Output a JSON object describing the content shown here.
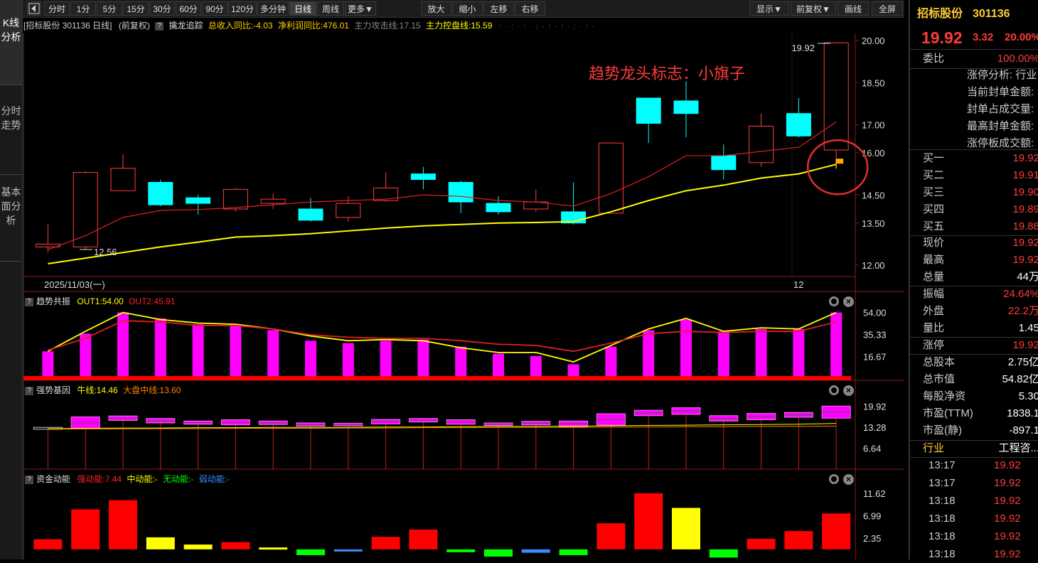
{
  "sidebar": {
    "tabs": [
      {
        "label": "K线分析",
        "active": true
      },
      {
        "label": "分时走势",
        "active": false
      },
      {
        "label": "基本面分析",
        "active": false
      }
    ]
  },
  "toolbar": {
    "back_icon": "triangle-left-icon",
    "periods": [
      "分时",
      "1分",
      "5分",
      "15分",
      "30分",
      "60分",
      "90分",
      "120分",
      "多分钟",
      "日线",
      "周线",
      "更多▼"
    ],
    "active_period": "日线",
    "actions": [
      "放大",
      "缩小",
      "左移",
      "右移"
    ],
    "right": [
      "显示▼",
      "前复权▼",
      "画线",
      "全屏"
    ]
  },
  "infobar": {
    "stock": "[招标股份 301136 日线]",
    "adjust": "(前复权)",
    "indicator": "擒龙追踪",
    "rev_label": "总收入同比:-4.03",
    "profit_label": "净利润同比:476.01",
    "attack_label": "主力攻击线:17.15",
    "control_label": "主力控盘线:15.59"
  },
  "annotation": "趋势龙头标志：小旗子",
  "main_chart": {
    "y_ticks": [
      "20.00",
      "18.50",
      "17.00",
      "16.00",
      "14.50",
      "13.50",
      "12.00"
    ],
    "date_label": "2025/11/03(一)",
    "month_label": "12",
    "high_label": "19.92",
    "low_label": "12.56"
  },
  "chart_data": {
    "type": "candlestick",
    "ylim": [
      12.0,
      20.0
    ],
    "candles": [
      {
        "o": 12.65,
        "c": 12.75,
        "h": 13.45,
        "l": 12.45,
        "up": true
      },
      {
        "o": 12.65,
        "c": 15.3,
        "h": 15.35,
        "l": 12.56,
        "up": true
      },
      {
        "o": 14.65,
        "c": 15.45,
        "h": 15.95,
        "l": 14.65,
        "up": true
      },
      {
        "o": 14.95,
        "c": 14.15,
        "h": 15.05,
        "l": 14.1,
        "up": false
      },
      {
        "o": 14.4,
        "c": 14.2,
        "h": 14.5,
        "l": 13.8,
        "up": false
      },
      {
        "o": 14.0,
        "c": 14.7,
        "h": 14.75,
        "l": 13.9,
        "up": true
      },
      {
        "o": 14.2,
        "c": 14.35,
        "h": 14.55,
        "l": 14.0,
        "up": true
      },
      {
        "o": 14.0,
        "c": 13.6,
        "h": 14.4,
        "l": 13.55,
        "up": false
      },
      {
        "o": 13.7,
        "c": 14.2,
        "h": 14.45,
        "l": 13.55,
        "up": true
      },
      {
        "o": 14.3,
        "c": 14.75,
        "h": 15.3,
        "l": 14.25,
        "up": true
      },
      {
        "o": 15.25,
        "c": 15.05,
        "h": 15.5,
        "l": 14.7,
        "up": false
      },
      {
        "o": 14.95,
        "c": 14.25,
        "h": 15.0,
        "l": 13.85,
        "up": false
      },
      {
        "o": 14.2,
        "c": 13.9,
        "h": 14.45,
        "l": 13.8,
        "up": false
      },
      {
        "o": 14.0,
        "c": 14.25,
        "h": 14.7,
        "l": 13.9,
        "up": true
      },
      {
        "o": 13.9,
        "c": 13.5,
        "h": 14.95,
        "l": 13.45,
        "up": false
      },
      {
        "o": 13.85,
        "c": 16.35,
        "h": 16.35,
        "l": 13.85,
        "up": true
      },
      {
        "o": 17.95,
        "c": 17.05,
        "h": 17.95,
        "l": 16.35,
        "up": false
      },
      {
        "o": 17.85,
        "c": 17.4,
        "h": 18.55,
        "l": 16.55,
        "up": false
      },
      {
        "o": 15.9,
        "c": 15.4,
        "h": 16.3,
        "l": 15.05,
        "up": false
      },
      {
        "o": 15.65,
        "c": 16.95,
        "h": 17.4,
        "l": 15.5,
        "up": true
      },
      {
        "o": 17.4,
        "c": 16.6,
        "h": 17.95,
        "l": 16.55,
        "up": false
      },
      {
        "o": 16.1,
        "c": 19.92,
        "h": 19.92,
        "l": 15.8,
        "up": true
      }
    ],
    "ma_red": [
      12.55,
      13.05,
      13.7,
      13.95,
      13.98,
      14.05,
      14.15,
      14.25,
      14.3,
      14.35,
      14.5,
      14.45,
      14.3,
      14.25,
      14.1,
      14.55,
      15.15,
      15.9,
      15.9,
      16.05,
      16.2,
      17.1
    ],
    "ma_yellow": [
      12.05,
      12.25,
      12.45,
      12.65,
      12.82,
      13.0,
      13.05,
      13.12,
      13.22,
      13.32,
      13.4,
      13.45,
      13.5,
      13.52,
      13.55,
      13.9,
      14.3,
      14.65,
      14.85,
      15.1,
      15.25,
      15.59
    ],
    "resonance": {
      "title": "趋势共振",
      "out1": "OUT1:54.00",
      "out2": "OUT2:45.91",
      "y_ticks": [
        "54.00",
        "35.33",
        "16.67"
      ],
      "ylim": [
        0,
        60
      ],
      "bars": [
        21,
        36,
        54,
        49,
        44,
        44,
        39,
        30,
        28,
        30,
        31,
        25,
        19,
        17,
        10,
        25,
        39,
        48,
        38,
        40,
        40,
        54
      ],
      "line1": [
        21,
        38,
        54,
        48,
        45,
        44,
        40,
        34,
        30,
        31,
        30,
        24,
        20,
        20,
        12,
        26,
        40,
        49,
        38,
        41,
        40,
        54
      ],
      "line2": [
        22,
        32,
        47,
        46,
        43,
        43,
        40,
        35,
        33,
        32,
        32,
        30,
        27,
        26,
        21,
        28,
        36,
        38,
        37,
        38,
        38,
        46
      ]
    },
    "gene": {
      "title": "强势基因",
      "bull": "牛线:14.46",
      "market": "大盘中线:13.60",
      "y_ticks": [
        "19.92",
        "13.28",
        "6.64"
      ],
      "ylim": [
        0,
        22
      ],
      "boxes": [
        [
          12.6,
          13.2
        ],
        [
          12.8,
          16.5
        ],
        [
          15.4,
          16.8
        ],
        [
          14.6,
          16.0
        ],
        [
          14.2,
          15.2
        ],
        [
          14.0,
          15.6
        ],
        [
          14.1,
          15.2
        ],
        [
          13.6,
          14.6
        ],
        [
          13.7,
          14.5
        ],
        [
          14.3,
          15.7
        ],
        [
          14.9,
          16.0
        ],
        [
          14.2,
          15.6
        ],
        [
          13.8,
          14.6
        ],
        [
          14.0,
          15.1
        ],
        [
          13.4,
          15.2
        ],
        [
          13.9,
          17.5
        ],
        [
          16.9,
          18.6
        ],
        [
          17.3,
          19.4
        ],
        [
          15.2,
          16.9
        ],
        [
          15.6,
          17.6
        ],
        [
          16.4,
          17.9
        ],
        [
          16.1,
          19.9
        ]
      ],
      "bull_line": [
        12.8,
        12.9,
        13.0,
        13.0,
        13.1,
        13.1,
        13.2,
        13.2,
        13.2,
        13.3,
        13.3,
        13.4,
        13.5,
        13.5,
        13.6,
        13.7,
        13.8,
        13.9,
        14.0,
        14.1,
        14.2,
        14.46
      ],
      "market_line": [
        12.6,
        12.7,
        12.7,
        12.8,
        12.8,
        12.9,
        12.9,
        12.9,
        13.0,
        13.0,
        13.1,
        13.1,
        13.2,
        13.2,
        13.2,
        13.3,
        13.3,
        13.4,
        13.4,
        13.5,
        13.5,
        13.6
      ]
    },
    "fund": {
      "title": "资金动能",
      "strong": "强动能:7.44",
      "mid": "中动能:-",
      "none": "无动能:-",
      "weak": "弱动能:-",
      "y_ticks": [
        "11.62",
        "6.99",
        "2.35"
      ],
      "ylim": [
        -1.5,
        12.5
      ],
      "bars": [
        {
          "v": 2.1,
          "c": "#ff0000"
        },
        {
          "v": 8.3,
          "c": "#ff0000"
        },
        {
          "v": 10.2,
          "c": "#ff0000"
        },
        {
          "v": 2.5,
          "c": "#ffff00"
        },
        {
          "v": 1.0,
          "c": "#ffff00"
        },
        {
          "v": 1.5,
          "c": "#ff0000"
        },
        {
          "v": 0.4,
          "c": "#ffff00"
        },
        {
          "v": -1.2,
          "c": "#00ff00"
        },
        {
          "v": -0.4,
          "c": "#3a8dff"
        },
        {
          "v": 2.6,
          "c": "#ff0000"
        },
        {
          "v": 4.1,
          "c": "#ff0000"
        },
        {
          "v": -0.6,
          "c": "#00ff00"
        },
        {
          "v": -1.5,
          "c": "#00ff00"
        },
        {
          "v": -0.7,
          "c": "#3a8dff"
        },
        {
          "v": -1.2,
          "c": "#00ff00"
        },
        {
          "v": 5.4,
          "c": "#ff0000"
        },
        {
          "v": 11.62,
          "c": "#ff0000"
        },
        {
          "v": 8.6,
          "c": "#ffff00"
        },
        {
          "v": -1.7,
          "c": "#00ff00"
        },
        {
          "v": 2.2,
          "c": "#ff0000"
        },
        {
          "v": 3.8,
          "c": "#ff0000"
        },
        {
          "v": 7.44,
          "c": "#ff0000"
        }
      ]
    }
  },
  "quote": {
    "name": "招标股份",
    "code": "301136",
    "price": "19.92",
    "change": "3.32",
    "pct": "20.00%",
    "weibi_label": "委比",
    "weibi": "100.00%",
    "limit_rows": [
      "涨停分析: 行业",
      "当前封单金额:",
      "封单占成交量:",
      "最高封单金额:",
      "涨停板成交额:"
    ],
    "bids": [
      {
        "label": "买一",
        "val": "19.92"
      },
      {
        "label": "买二",
        "val": "19.91"
      },
      {
        "label": "买三",
        "val": "19.90"
      },
      {
        "label": "买四",
        "val": "19.89"
      },
      {
        "label": "买五",
        "val": "19.88"
      }
    ],
    "stats1": [
      {
        "label": "现价",
        "val": "19.92",
        "red": true
      },
      {
        "label": "最高",
        "val": "19.92",
        "red": true
      },
      {
        "label": "总量",
        "val": "44万",
        "red": false
      }
    ],
    "stats2": [
      {
        "label": "振幅",
        "val": "24.64%",
        "red": true
      },
      {
        "label": "外盘",
        "val": "22.2万",
        "red": true
      },
      {
        "label": "量比",
        "val": "1.45",
        "red": false
      }
    ],
    "stats3": [
      {
        "label": "涨停",
        "val": "19.92",
        "red": true
      }
    ],
    "stats4": [
      {
        "label": "总股本",
        "val": "2.75亿",
        "red": false
      },
      {
        "label": "总市值",
        "val": "54.82亿",
        "red": false
      },
      {
        "label": "每股净资",
        "val": "5.30",
        "red": false
      },
      {
        "label": "市盈(TTM)",
        "val": "1838.1",
        "red": false
      },
      {
        "label": "市盈(静)",
        "val": "-897.1",
        "red": false
      }
    ],
    "industry_label": "行业",
    "industry": "工程咨...",
    "ticks": [
      {
        "t": "13:17",
        "p": "19.92"
      },
      {
        "t": "13:17",
        "p": "19.92"
      },
      {
        "t": "13:18",
        "p": "19.92"
      },
      {
        "t": "13:18",
        "p": "19.92"
      },
      {
        "t": "13:18",
        "p": "19.92"
      },
      {
        "t": "13:18",
        "p": "19.92"
      }
    ]
  }
}
